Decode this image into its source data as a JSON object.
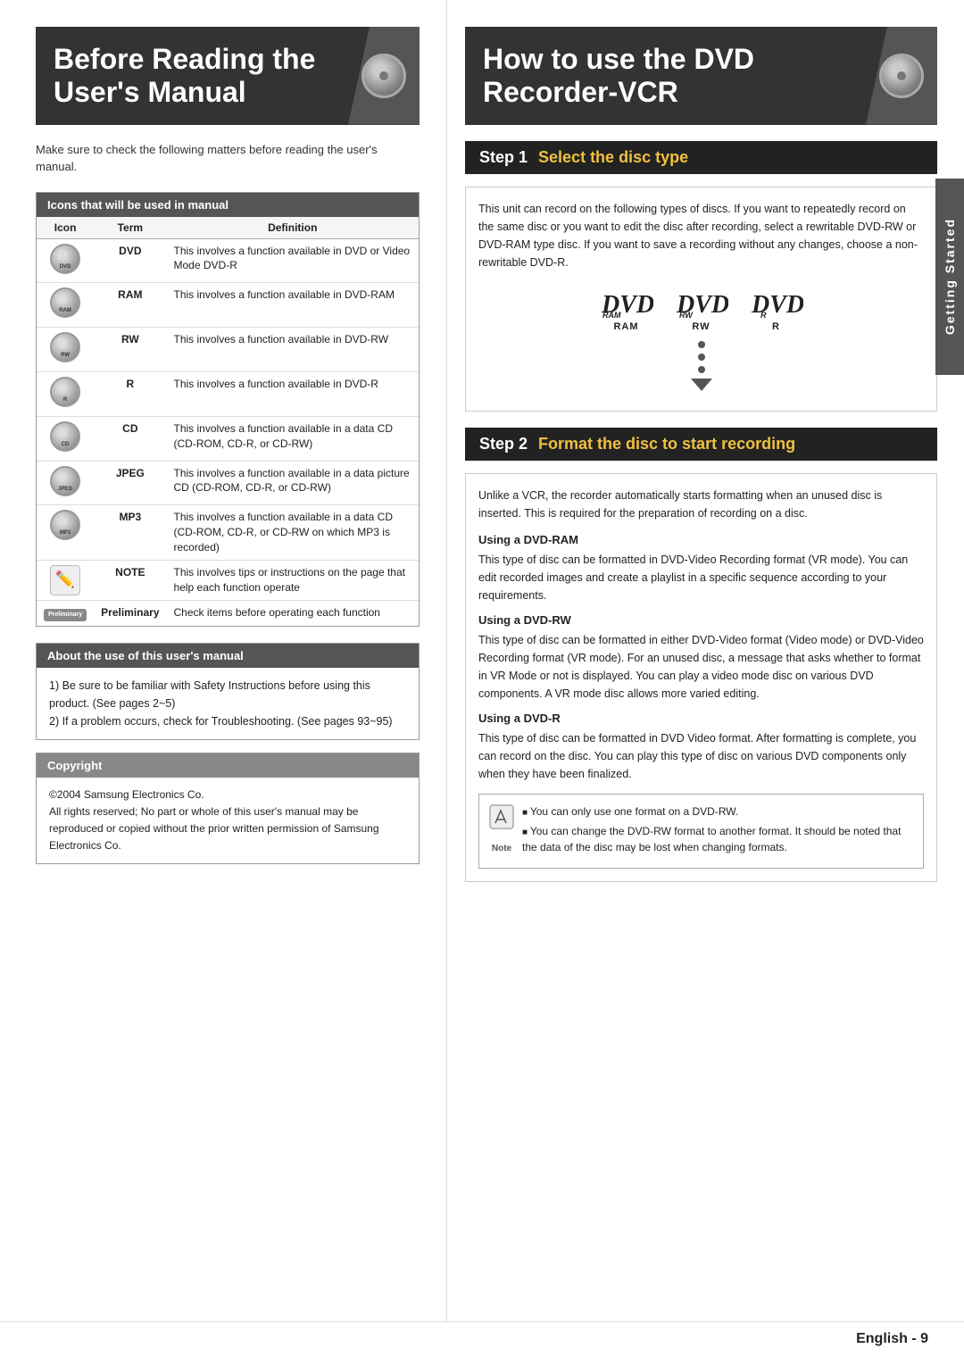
{
  "left": {
    "title_line1": "Before Reading the",
    "title_line2": "User's Manual",
    "intro_text": "Make sure to check the following matters before reading the user's manual.",
    "icons_table": {
      "header": "Icons that will be used in manual",
      "columns": [
        "Icon",
        "Term",
        "Definition"
      ],
      "rows": [
        {
          "icon_type": "disc",
          "icon_label": "DVD",
          "term": "DVD",
          "definition": "This involves a function available in DVD or Video Mode DVD-R"
        },
        {
          "icon_type": "disc",
          "icon_label": "RAM",
          "term": "RAM",
          "definition": "This involves a function available in DVD-RAM"
        },
        {
          "icon_type": "disc",
          "icon_label": "RW",
          "term": "RW",
          "definition": "This involves a function available in DVD-RW"
        },
        {
          "icon_type": "disc",
          "icon_label": "R",
          "term": "R",
          "definition": "This involves a function available in DVD-R"
        },
        {
          "icon_type": "disc",
          "icon_label": "CD",
          "term": "CD",
          "definition": "This involves a function available in a data CD (CD-ROM, CD-R, or CD-RW)"
        },
        {
          "icon_type": "disc",
          "icon_label": "JPEG",
          "term": "JPEG",
          "definition": "This involves a function available in a data picture CD (CD-ROM, CD-R, or CD-RW)"
        },
        {
          "icon_type": "disc",
          "icon_label": "MP3",
          "term": "MP3",
          "definition": "This involves a function available in a data CD (CD-ROM, CD-R, or CD-RW on which MP3 is recorded)"
        },
        {
          "icon_type": "note",
          "icon_label": "NOTE",
          "term": "NOTE",
          "definition": "This involves tips or instructions on the page that help each function operate"
        },
        {
          "icon_type": "prelim",
          "icon_label": "Preliminary",
          "term": "Preliminary",
          "definition": "Check items before operating each function"
        }
      ]
    },
    "about": {
      "header": "About the use of this user's manual",
      "items": [
        "1) Be sure to be familiar with Safety Instructions before using this product. (See pages 2~5)",
        "2) If a problem occurs, check for Troubleshooting. (See pages 93~95)"
      ]
    },
    "copyright": {
      "header": "Copyright",
      "content_line1": "©2004 Samsung Electronics Co.",
      "content_line2": "All rights reserved; No part or whole of this user's manual may be reproduced or copied without the prior written permission of Samsung Electronics Co."
    }
  },
  "right": {
    "title_line1": "How to use the DVD",
    "title_line2": "Recorder-VCR",
    "side_tab": "Getting Started",
    "step1": {
      "num": "Step 1",
      "title": "Select the disc type",
      "intro": "This unit can record on the following types of discs. If you want to repeatedly record on the same disc or you want to edit the disc after recording, select a rewritable DVD-RW or DVD-RAM type disc. If you want to save a recording without any changes, choose a non-rewritable DVD-R.",
      "disc_logos": [
        {
          "label": "RAM"
        },
        {
          "label": "RW"
        },
        {
          "label": "R"
        }
      ]
    },
    "step2": {
      "num": "Step 2",
      "title": "Format the disc to start recording",
      "intro": "Unlike a VCR, the recorder automatically starts formatting when an unused disc is inserted. This is required for the preparation of recording on a disc.",
      "subsections": [
        {
          "heading": "Using a DVD-RAM",
          "text": "This type of disc can be formatted in DVD-Video Recording format (VR mode). You can edit recorded images and create a playlist in a specific sequence according to your requirements."
        },
        {
          "heading": "Using a DVD-RW",
          "text": "This type of disc can be formatted in either DVD-Video format (Video mode) or DVD-Video Recording format (VR mode). For an unused disc, a message that asks whether to format in VR Mode or not is displayed. You can play a video mode disc on various DVD components. A VR mode disc allows more varied editing."
        },
        {
          "heading": "Using a DVD-R",
          "text": "This type of disc can be formatted in DVD Video format. After formatting is complete, you can record on the disc. You can play this type of disc on various DVD components only when they have been finalized."
        }
      ],
      "note_items": [
        "You can only use one format on a DVD-RW.",
        "You can change the DVD-RW format to another format. It should be noted that the data of the disc may be lost when changing formats."
      ]
    }
  },
  "footer": {
    "page_text": "English - 9"
  }
}
